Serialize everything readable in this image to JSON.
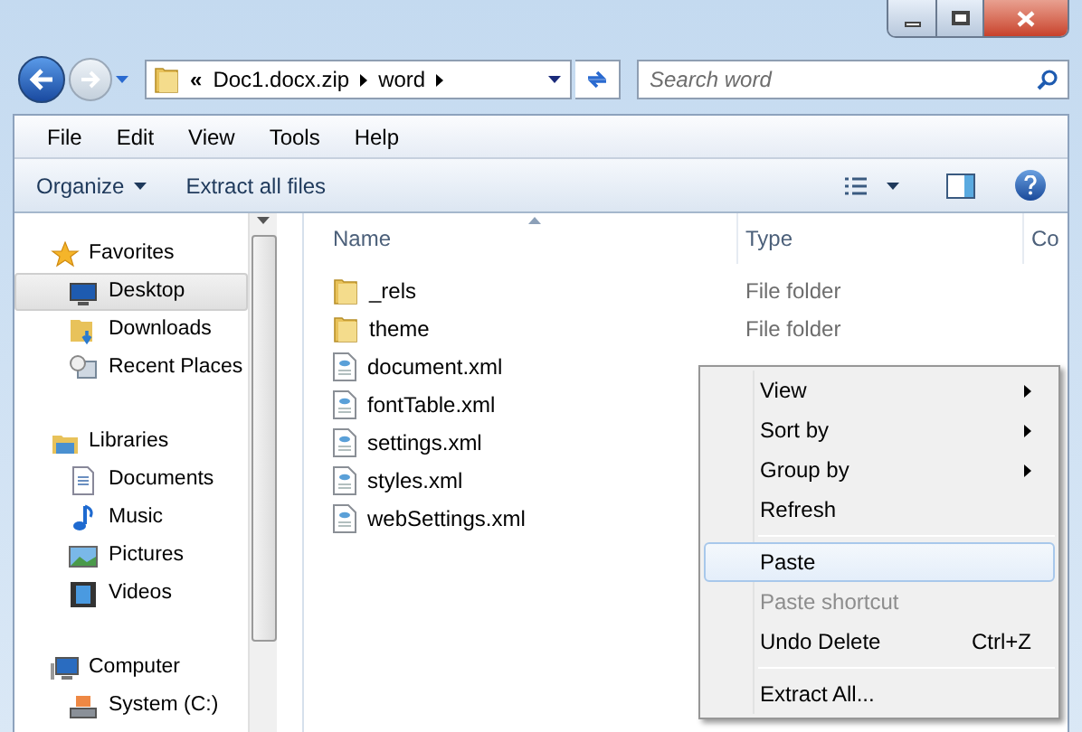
{
  "address_bar": {
    "overflow": "«",
    "segments": [
      "Doc1.docx.zip",
      "word"
    ]
  },
  "search": {
    "placeholder": "Search word"
  },
  "menu_bar": [
    "File",
    "Edit",
    "View",
    "Tools",
    "Help"
  ],
  "command_bar": {
    "buttons": [
      {
        "label": "Organize",
        "dropdown": true
      },
      {
        "label": "Extract all files",
        "dropdown": false
      }
    ]
  },
  "sidebar": {
    "groups": [
      {
        "label": "Favorites",
        "children": [
          {
            "label": "Desktop",
            "selected": true
          },
          {
            "label": "Downloads",
            "selected": false
          },
          {
            "label": "Recent Places",
            "selected": false
          }
        ]
      },
      {
        "label": "Libraries",
        "children": [
          {
            "label": "Documents",
            "selected": false
          },
          {
            "label": "Music",
            "selected": false
          },
          {
            "label": "Pictures",
            "selected": false
          },
          {
            "label": "Videos",
            "selected": false
          }
        ]
      },
      {
        "label": "Computer",
        "children": [
          {
            "label": "System (C:)",
            "selected": false
          }
        ]
      }
    ]
  },
  "file_list": {
    "columns": [
      "Name",
      "Type",
      "Co"
    ],
    "rows": [
      {
        "name": "_rels",
        "type": "File folder",
        "kind": "folder"
      },
      {
        "name": "theme",
        "type": "File folder",
        "kind": "folder"
      },
      {
        "name": "document.xml",
        "kind": "xml"
      },
      {
        "name": "fontTable.xml",
        "kind": "xml"
      },
      {
        "name": "settings.xml",
        "kind": "xml"
      },
      {
        "name": "styles.xml",
        "kind": "xml"
      },
      {
        "name": "webSettings.xml",
        "kind": "xml"
      }
    ]
  },
  "context_menu": {
    "items": [
      {
        "kind": "item",
        "label": "View",
        "submenu": true,
        "selected": false,
        "disabled": false
      },
      {
        "kind": "item",
        "label": "Sort by",
        "submenu": true,
        "selected": false,
        "disabled": false
      },
      {
        "kind": "item",
        "label": "Group by",
        "submenu": true,
        "selected": false,
        "disabled": false
      },
      {
        "kind": "item",
        "label": "Refresh",
        "submenu": false,
        "selected": false,
        "disabled": false
      },
      {
        "kind": "separator"
      },
      {
        "kind": "item",
        "label": "Paste",
        "submenu": false,
        "selected": true,
        "disabled": false
      },
      {
        "kind": "item",
        "label": "Paste shortcut",
        "submenu": false,
        "selected": false,
        "disabled": true
      },
      {
        "kind": "item",
        "label": "Undo Delete",
        "shortcut": "Ctrl+Z",
        "submenu": false,
        "selected": false,
        "disabled": false
      },
      {
        "kind": "separator"
      },
      {
        "kind": "item",
        "label": "Extract All...",
        "submenu": false,
        "selected": false,
        "disabled": false
      }
    ]
  }
}
